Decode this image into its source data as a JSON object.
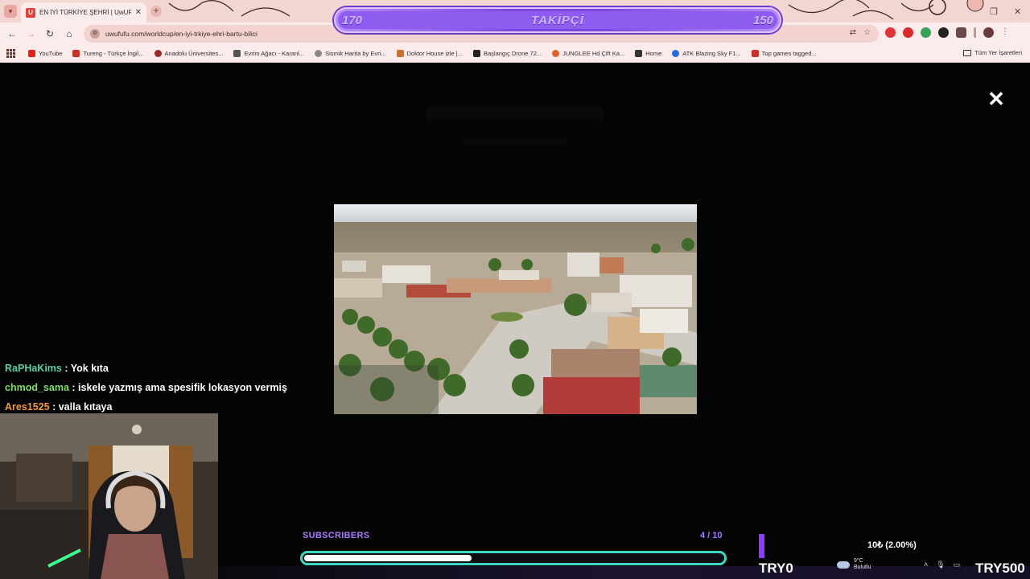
{
  "browser": {
    "tab_title": "EN İYİ TÜRKİYE ŞEHRİ | UwUFU...",
    "tab_favicon": "U",
    "url": "uwufufu.com/worldcup/en-iyi-trkiye-ehri-bartu-bilici",
    "bookmarks": [
      {
        "label": "YouTube",
        "color": "#e62117"
      },
      {
        "label": "Tureng - Türkçe İngil...",
        "color": "#c8312a"
      },
      {
        "label": "Anadolu Üniversites...",
        "color": "#9a2a2a"
      },
      {
        "label": "Evrim Ağacı - Karanl...",
        "color": "#555555"
      },
      {
        "label": "Sismik Harita by Evri...",
        "color": "#888888"
      },
      {
        "label": "Doktor House izle |...",
        "color": "#d0702a"
      },
      {
        "label": "Başlangıç Drone 72...",
        "color": "#222222"
      },
      {
        "label": "JUNGLEE Hd Çift Ka...",
        "color": "#e0602a"
      },
      {
        "label": "Home",
        "color": "#333333"
      },
      {
        "label": "ATK Blazing Sky F1...",
        "color": "#2a6ae0"
      },
      {
        "label": "Top games tagged...",
        "color": "#c8312a"
      }
    ],
    "all_bookmarks": "Tüm Yer İşaretleri"
  },
  "followers": {
    "current": "170",
    "title": "TAKİPÇİ",
    "goal": "150"
  },
  "chat": [
    {
      "user": "RaPHaKims",
      "text": " : Yok kıta"
    },
    {
      "user": "chmod_sama",
      "text": " : iskele yazmış ama spesifik lokasyon vermiş"
    },
    {
      "user": "Ares1525",
      "text": " : valla kıtaya"
    }
  ],
  "subscribers": {
    "label": "SUBSCRIBERS",
    "count": "4 / 10",
    "progress": 0.4
  },
  "donation": {
    "left": "TRY0",
    "right": "TRY500",
    "percent": "10₺ (2.00%)"
  },
  "weather": {
    "temp": "9°C",
    "desc": "Bulutlu"
  },
  "colors": {
    "accent_purple": "#8f5cf0",
    "sub_bar_border": "#3ed8c2"
  }
}
